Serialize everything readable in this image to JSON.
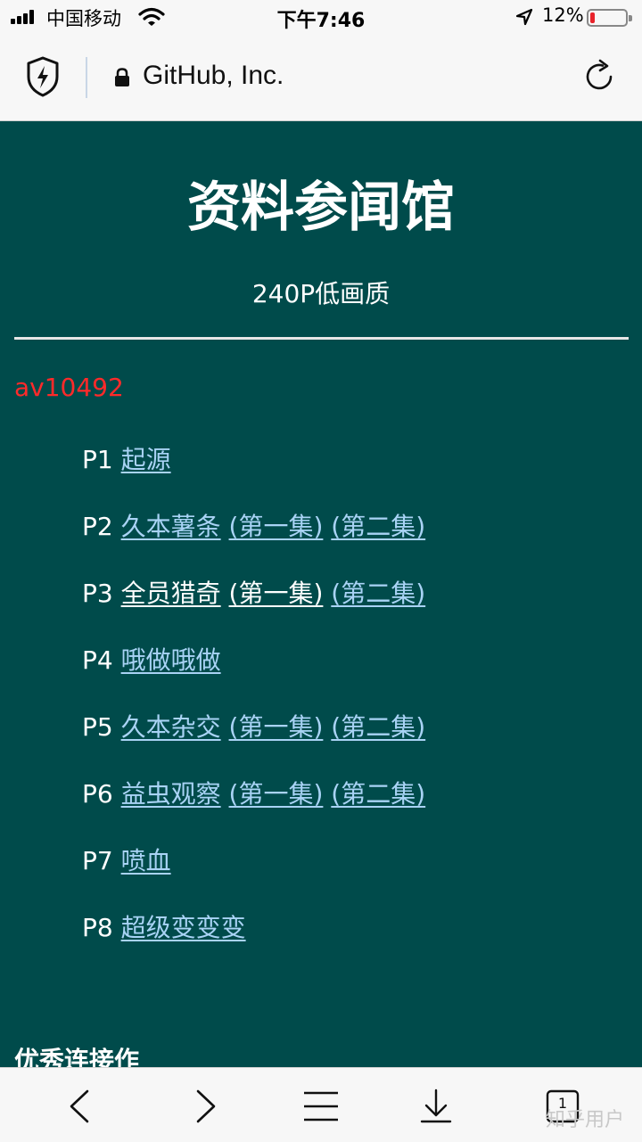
{
  "status_bar": {
    "carrier": "中国移动",
    "time": "下午7:46",
    "battery_percent": "12%",
    "battery_level": 0.12
  },
  "address_bar": {
    "site": "GitHub, Inc."
  },
  "page": {
    "title": "资料参闻馆",
    "subtitle": "240P低画质",
    "av_id": "av10492",
    "parts": [
      {
        "label": "P1",
        "links": [
          "起源"
        ]
      },
      {
        "label": "P2",
        "links": [
          "久本薯条",
          "(第一集)",
          "(第二集)"
        ]
      },
      {
        "label": "P3",
        "links": [
          "全员猎奇",
          "(第一集)",
          "(第二集)"
        ]
      },
      {
        "label": "P4",
        "links": [
          "哦做哦做"
        ]
      },
      {
        "label": "P5",
        "links": [
          "久本杂交",
          "(第一集)",
          "(第二集)"
        ]
      },
      {
        "label": "P6",
        "links": [
          "益虫观察",
          "(第一集)",
          "(第二集)"
        ]
      },
      {
        "label": "P7",
        "links": [
          "喷血"
        ]
      },
      {
        "label": "P8",
        "links": [
          "超级变变变"
        ]
      }
    ],
    "section_heading": "优秀连接作"
  },
  "toolbar": {
    "tab_count": "1",
    "watermark": "知乎用户"
  },
  "colors": {
    "page_bg": "#004b4b",
    "link": "#a9d3f5",
    "visited_link": "#ffffff",
    "av_red": "#ff2a2a"
  }
}
